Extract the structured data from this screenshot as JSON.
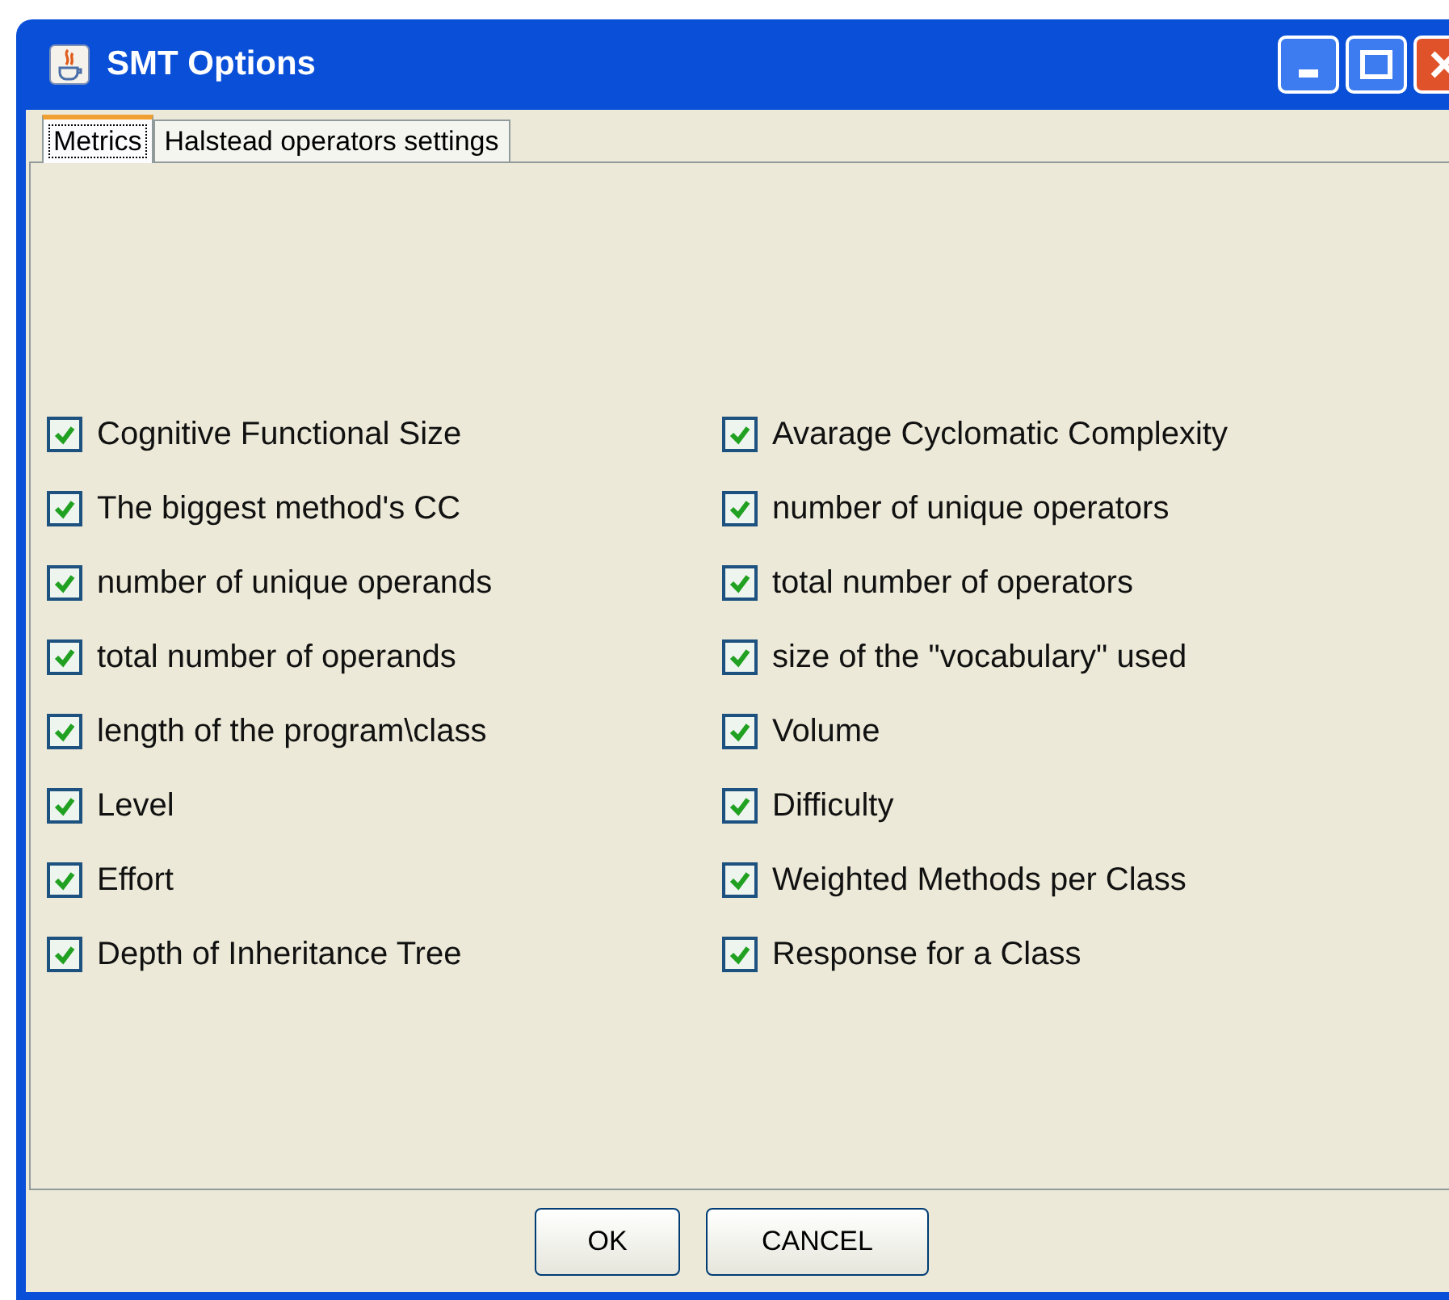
{
  "window": {
    "title": "SMT Options"
  },
  "tabs": [
    {
      "label": "Metrics",
      "selected": true
    },
    {
      "label": "Halstead operators settings",
      "selected": false
    }
  ],
  "metrics": [
    {
      "label": "Cognitive Functional Size",
      "checked": true
    },
    {
      "label": "The biggest method's CC",
      "checked": true
    },
    {
      "label": "number of unique operands",
      "checked": true
    },
    {
      "label": "total number of operands",
      "checked": true
    },
    {
      "label": "length of the program\\class",
      "checked": true
    },
    {
      "label": "Level",
      "checked": true
    },
    {
      "label": "Effort",
      "checked": true
    },
    {
      "label": "Depth of Inheritance Tree",
      "checked": true
    },
    {
      "label": "Avarage Cyclomatic Complexity",
      "checked": true
    },
    {
      "label": "number of unique operators",
      "checked": true
    },
    {
      "label": "total number of operators",
      "checked": true
    },
    {
      "label": "size of the \"vocabulary\" used",
      "checked": true
    },
    {
      "label": "Volume",
      "checked": true
    },
    {
      "label": "Difficulty",
      "checked": true
    },
    {
      "label": "Weighted Methods per Class",
      "checked": true
    },
    {
      "label": "Response for a Class",
      "checked": true
    }
  ],
  "buttons": [
    "OK",
    "CANCEL"
  ]
}
